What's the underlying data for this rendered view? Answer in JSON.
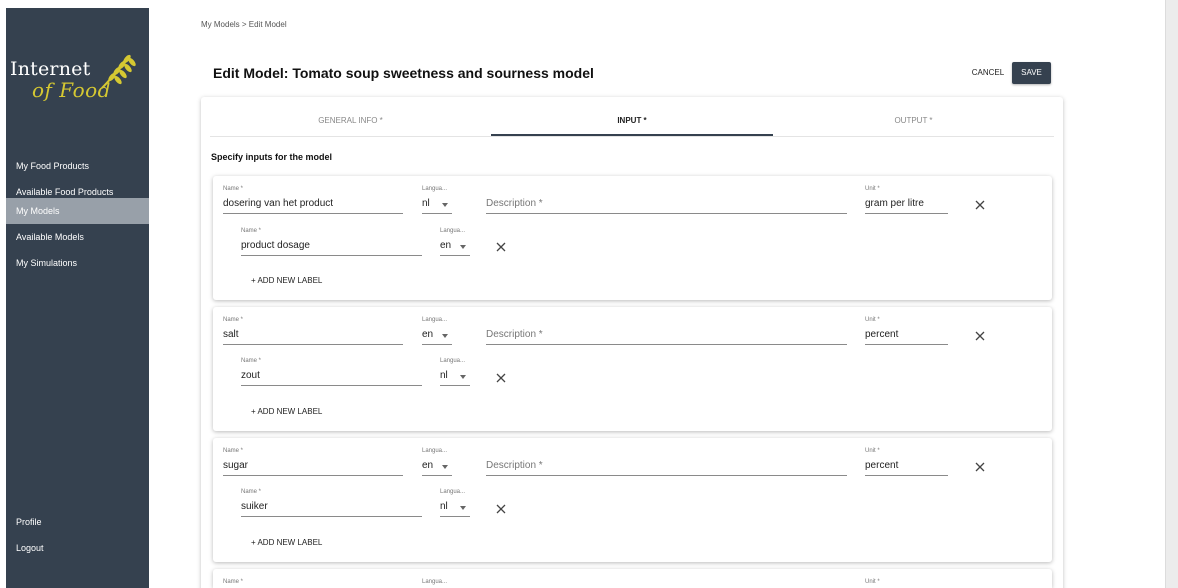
{
  "app": {
    "logo_line1": "Internet",
    "logo_line2": "of Food",
    "accent_color": "#35414f",
    "logo_color": "#d5c832"
  },
  "sidebar": {
    "items": [
      {
        "label": "My Food Products",
        "active": false
      },
      {
        "label": "Available Food Products",
        "active": false
      },
      {
        "label": "My Models",
        "active": true
      },
      {
        "label": "Available Models",
        "active": false
      },
      {
        "label": "My Simulations",
        "active": false
      }
    ],
    "bottom_items": [
      {
        "label": "Profile"
      },
      {
        "label": "Logout"
      }
    ]
  },
  "breadcrumb": "My Models > Edit Model",
  "page_title": "Edit Model: Tomato soup sweetness and sourness model",
  "actions": {
    "cancel_label": "CANCEL",
    "save_label": "SAVE"
  },
  "tabs": [
    {
      "label": "GENERAL INFO *",
      "active": false
    },
    {
      "label": "INPUT *",
      "active": true
    },
    {
      "label": "OUTPUT *",
      "active": false
    }
  ],
  "section_heading": "Specify inputs for the model",
  "field_labels": {
    "name": "Name *",
    "language": "Langua...",
    "description_placeholder": "Description *",
    "unit": "Unit *",
    "add_label": "+ ADD NEW LABEL"
  },
  "inputs": [
    {
      "name": "dosering van het product",
      "language": "nl",
      "description": "",
      "unit": "gram per litre",
      "label": {
        "name": "product dosage",
        "language": "en"
      }
    },
    {
      "name": "salt",
      "language": "en",
      "description": "",
      "unit": "percent",
      "label": {
        "name": "zout",
        "language": "nl"
      }
    },
    {
      "name": "sugar",
      "language": "en",
      "description": "",
      "unit": "percent",
      "label": {
        "name": "suiker",
        "language": "nl"
      }
    },
    {
      "name": "",
      "language": "",
      "description": "",
      "unit": ""
    }
  ]
}
